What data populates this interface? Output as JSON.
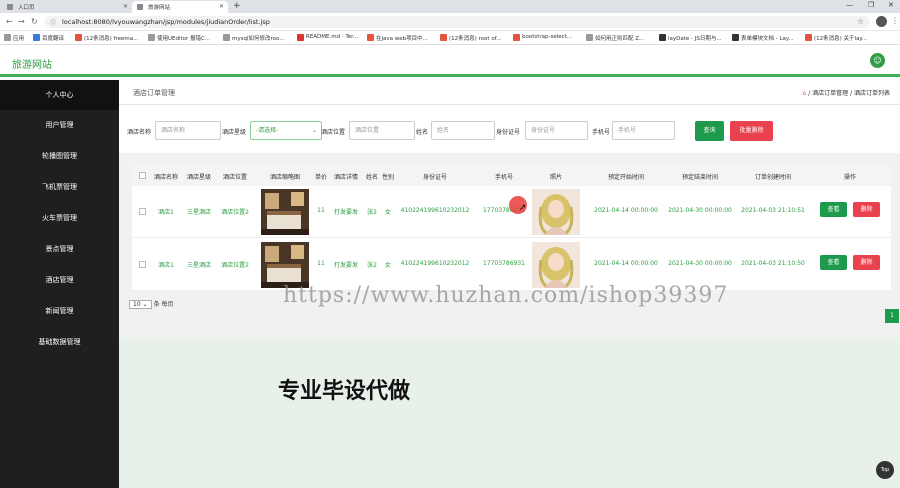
{
  "browser": {
    "tabs": [
      {
        "label": "入口页",
        "active": false
      },
      {
        "label": "旅游网站",
        "active": true
      }
    ],
    "url": "localhost:8080/lvyouwangzhan/jsp/modules/jiudianOrder/list.jsp",
    "bookmarks": [
      "应用",
      "百度翻译",
      "(12条消息) freema...",
      "使用UEditor 报错C...",
      "mysql如何修改roo...",
      "README.md · Ter...",
      "在java web项目中...",
      "(12条消息) root of...",
      "bootstrap-select...",
      "如何用正则匹配 Z...",
      "layDate - JS日期与...",
      "表单模块文档 - Lay...",
      "(12条消息) 关于lay..."
    ]
  },
  "header": {
    "brand": "旅游网站",
    "avatar_icon": "user-icon",
    "accent_color": "#3fae54"
  },
  "sidebar": {
    "items": [
      "个人中心",
      "用户管理",
      "轮播图管理",
      "飞机票管理",
      "火车票管理",
      "景点管理",
      "酒店管理",
      "新闻管理",
      "基础数据管理"
    ]
  },
  "breadcrumb": {
    "title": "酒店订单管理",
    "trail": "/ 酒店订单管理 / 酒店订单列表"
  },
  "search": {
    "fields": [
      {
        "label": "酒店名称",
        "placeholder": "酒店名称"
      },
      {
        "label": "酒店星级",
        "value": "-请选择-"
      },
      {
        "label": "酒店位置",
        "placeholder": "酒店位置"
      },
      {
        "label": "姓名",
        "placeholder": "姓名"
      },
      {
        "label": "身份证号",
        "placeholder": "身份证号"
      },
      {
        "label": "手机号",
        "placeholder": "手机号"
      }
    ],
    "query_button": "查询",
    "batch_delete_button": "批量删除"
  },
  "table": {
    "columns": [
      "酒店名称",
      "酒店星级",
      "酒店位置",
      "酒店缩略图",
      "单价",
      "酒店详情",
      "姓名",
      "性别",
      "身份证号",
      "手机号",
      "照片",
      "预定开始时间",
      "预定结束时间",
      "订单创建时间",
      "操作"
    ],
    "rows": [
      {
        "name": "酒店1",
        "star": "三星酒店",
        "location": "酒店位置2",
        "price": "11",
        "detail": "打发要发",
        "person": "张2",
        "gender": "女",
        "idcard": "410224199610232012",
        "phone": "17703786931",
        "start": "2021-04-14 00:00:00",
        "end": "2021-04-30 00:00:00",
        "created": "2021-04-03 21:10:51"
      },
      {
        "name": "酒店1",
        "star": "三星酒店",
        "location": "酒店位置2",
        "price": "11",
        "detail": "打发要发",
        "person": "张2",
        "gender": "女",
        "idcard": "410224199610232012",
        "phone": "17703786931",
        "start": "2021-04-14 00:00:00",
        "end": "2021-04-30 00:00:00",
        "created": "2021-04-03 21:10:50"
      }
    ],
    "view_button": "查看",
    "delete_button": "删除"
  },
  "pager": {
    "page_size": "10",
    "per_page_suffix": "条 每页",
    "current_page": "1"
  },
  "overlay": {
    "watermark": "https://www.huzhan.com/ishop39397",
    "promo": "专业毕设代做",
    "top_button": "Top"
  }
}
